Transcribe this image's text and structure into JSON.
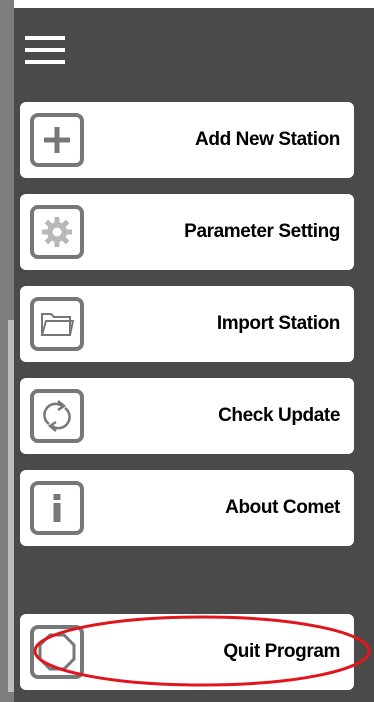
{
  "menu": {
    "items": [
      {
        "id": "add-new-station",
        "label": "Add New Station",
        "icon": "plus-icon"
      },
      {
        "id": "parameter-setting",
        "label": "Parameter Setting",
        "icon": "gear-icon"
      },
      {
        "id": "import-station",
        "label": "Import Station",
        "icon": "folder-icon"
      },
      {
        "id": "check-update",
        "label": "Check Update",
        "icon": "refresh-icon"
      },
      {
        "id": "about-comet",
        "label": "About Comet",
        "icon": "info-icon"
      },
      {
        "id": "quit-program",
        "label": "Quit Program",
        "icon": "octagon-icon"
      }
    ]
  },
  "colors": {
    "panel_background": "#4a4a4a",
    "button_background": "#ffffff",
    "icon_border": "#777777",
    "highlight_ellipse": "#e0161d"
  }
}
